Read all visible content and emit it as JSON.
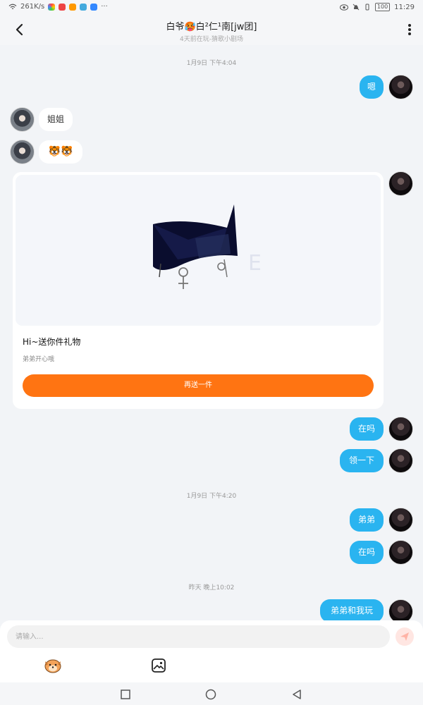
{
  "status_bar": {
    "speed": "261K/s",
    "battery": "100",
    "time": "11:29"
  },
  "header": {
    "title": "白爷🥵白²仁¹南[jw团]",
    "subtitle": "4天前在玩-猜歌小剧场"
  },
  "messages": {
    "time_1": "1月9日 下午4:04",
    "out_1": "嗯",
    "in_1": "姐姐",
    "in_2": "🐯🐯",
    "time_2": "1月9日 下午4:20",
    "out_2": "在吗",
    "out_3": "领一下",
    "out_4": "弟弟",
    "out_5": "在吗",
    "time_3": "昨天 晚上10:02",
    "out_6": "弟弟和我玩"
  },
  "gift_card": {
    "title": "Hi~送你件礼物",
    "subtitle": "弟弟开心哦",
    "button": "再送一件"
  },
  "input": {
    "placeholder": "请输入..."
  },
  "icons": {
    "back": "back-arrow-icon",
    "more": "more-vertical-icon",
    "send": "send-icon",
    "emoji": "emoji-icon",
    "image": "image-icon"
  },
  "colors": {
    "bubble_out": "#2ab4f0",
    "gift_button": "#ff7412",
    "background": "#f2f4f7"
  }
}
